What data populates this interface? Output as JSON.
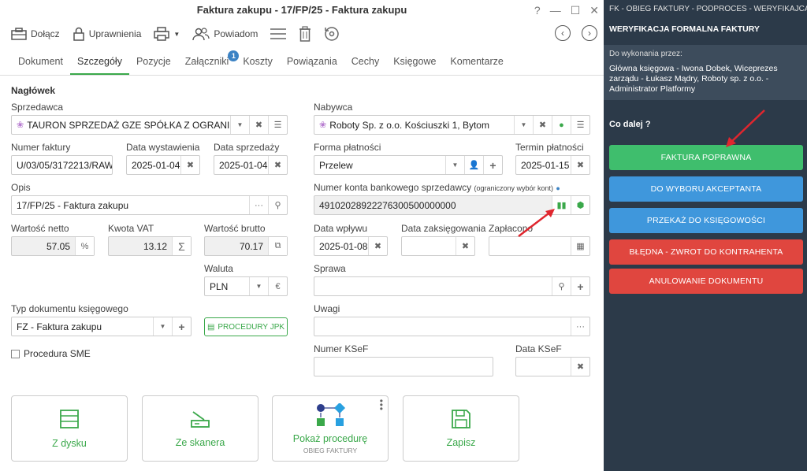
{
  "window": {
    "title": "Faktura zakupu - 17/FP/25 - Faktura zakupu",
    "controls": [
      "?",
      "—",
      "☐",
      "✕"
    ]
  },
  "toolbar": {
    "attach": "Dołącz",
    "permissions": "Uprawnienia",
    "notify": "Powiadom"
  },
  "tabs": [
    "Dokument",
    "Szczegóły",
    "Pozycje",
    "Załączniki",
    "Koszty",
    "Powiązania",
    "Cechy",
    "Księgowe",
    "Komentarze"
  ],
  "tab_badge": "1",
  "form": {
    "section": "Nagłówek",
    "seller_label": "Sprzedawca",
    "seller_value": "TAURON SPRZEDAŻ GZE SPÓŁKA Z OGRANICZO...",
    "buyer_label": "Nabywca",
    "buyer_value": "Roboty Sp. z o.o. Kościuszki 1, Bytom",
    "invoice_no_label": "Numer faktury",
    "invoice_no_value": "U/03/05/3172213/RAW",
    "issue_date_label": "Data wystawienia",
    "issue_date_value": "2025-01-04",
    "sale_date_label": "Data sprzedaży",
    "sale_date_value": "2025-01-04",
    "payment_form_label": "Forma płatności",
    "payment_form_value": "Przelew",
    "payment_due_label": "Termin płatności",
    "payment_due_value": "2025-01-15",
    "desc_label": "Opis",
    "desc_value": "17/FP/25 - Faktura zakupu",
    "account_label": "Numer konta bankowego sprzedawcy",
    "account_hint": "(ograniczony wybór kont)",
    "account_value": "49102028922276300500000000",
    "net_label": "Wartość netto",
    "net_value": "57.05",
    "net_suffix": "%",
    "vat_label": "Kwota VAT",
    "vat_value": "13.12",
    "gross_label": "Wartość brutto",
    "gross_value": "70.17",
    "inflow_label": "Data wpływu",
    "inflow_value": "2025-01-08",
    "booking_label": "Data zaksięgowania",
    "paid_label": "Zapłacono",
    "currency_label": "Waluta",
    "currency_value": "PLN",
    "currency_suffix": "€",
    "case_label": "Sprawa",
    "doc_type_label": "Typ dokumentu księgowego",
    "doc_type_value": "FZ - Faktura zakupu",
    "jpk_button": "PROCEDURY JPK",
    "notes_label": "Uwagi",
    "sme_label": "Procedura SME",
    "ksef_no_label": "Numer KSeF",
    "ksef_date_label": "Data KSeF"
  },
  "cards": [
    {
      "title": "Z dysku",
      "sub": ""
    },
    {
      "title": "Ze skanera",
      "sub": ""
    },
    {
      "title": "Pokaż procedurę",
      "sub": "OBIEG FAKTURY"
    },
    {
      "title": "Zapisz",
      "sub": ""
    }
  ],
  "sidebar": {
    "header": "FK - OBIEG FAKTURY - PODPROCES - WERYFIKAJCA FORMALNA",
    "step": "WERYFIKACJA FORMALNA FAKTURY",
    "todo_label": "Do wykonania przez:",
    "todo_value": "Główna księgowa - Iwona Dobek, Wiceprezes zarządu - Łukasz Mądry, Roboty sp. z o.o. - Administrator Platformy",
    "next_label": "Co dalej ?",
    "buttons": [
      {
        "label": "FAKTURA POPRAWNA",
        "color": "#3fbe6d"
      },
      {
        "label": "DO WYBORU AKCEPTANTA",
        "color": "#3f97dc"
      },
      {
        "label": "PRZEKAŻ DO KSIĘGOWOŚCI",
        "color": "#3f97dc"
      },
      {
        "label": "BŁĘDNA - ZWROT DO KONTRAHENTA",
        "color": "#e0463f"
      },
      {
        "label": "ANULOWANIE DOKUMENTU",
        "color": "#e0463f"
      }
    ]
  },
  "colors": {
    "accent": "#3aa84a",
    "sidebar_bg": "#2c3a49",
    "arrow": "#e0262e"
  }
}
